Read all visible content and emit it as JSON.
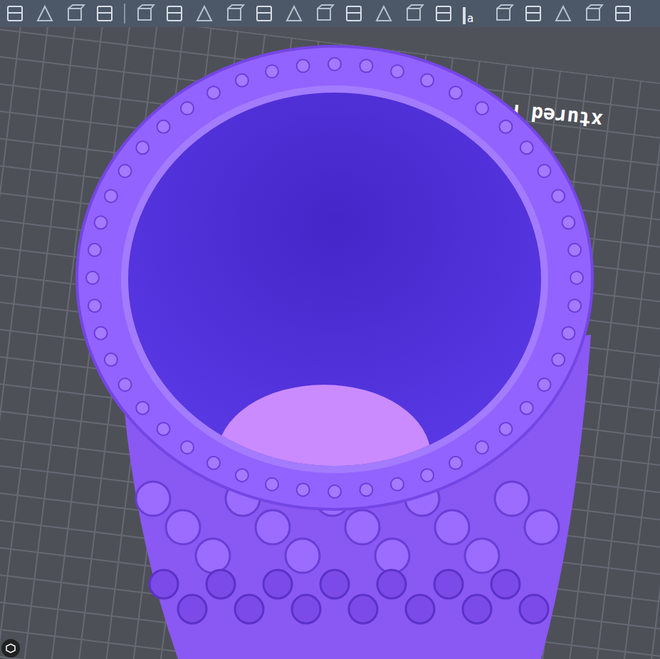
{
  "toolbar": {
    "text_tool_label": "a"
  },
  "plate": {
    "label": "xtured P"
  }
}
